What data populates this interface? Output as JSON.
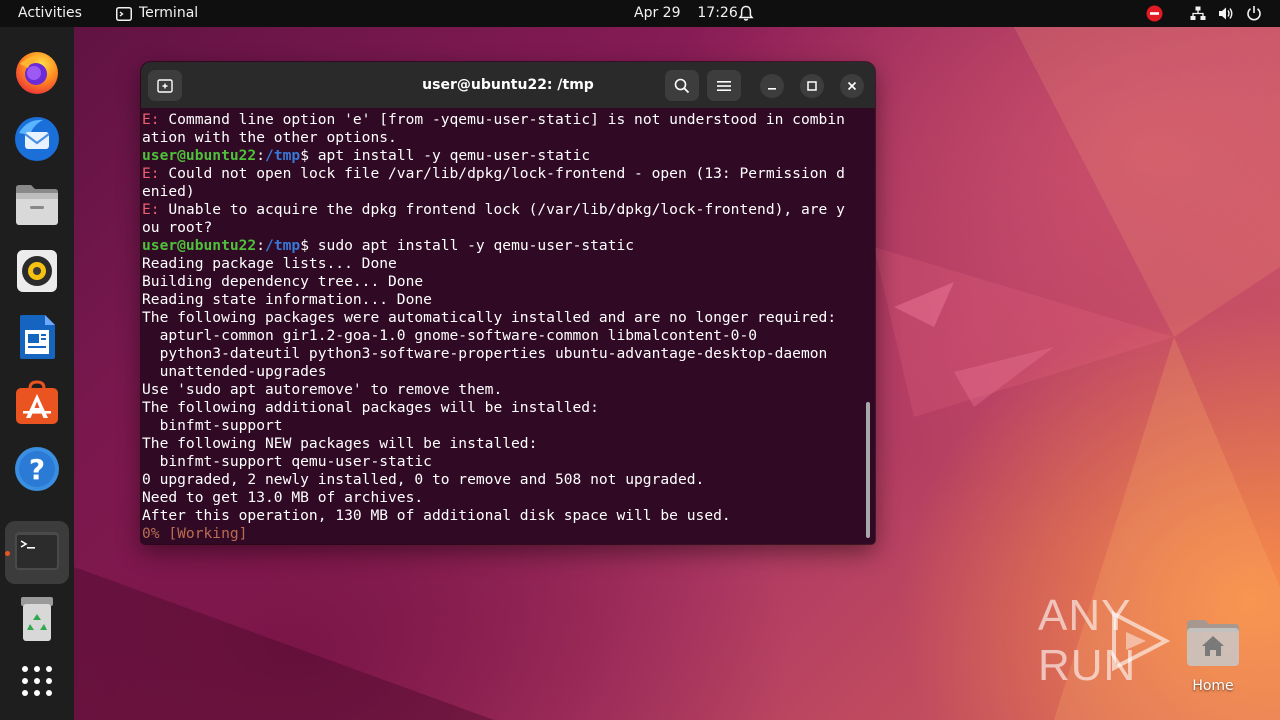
{
  "topbar": {
    "activities": "Activities",
    "app_name": "Terminal",
    "date": "Apr 29",
    "time": "17:26"
  },
  "dock": {
    "apps": [
      {
        "name": "Firefox",
        "icon": "firefox-icon"
      },
      {
        "name": "Thunderbird",
        "icon": "thunderbird-icon"
      },
      {
        "name": "Files",
        "icon": "files-icon"
      },
      {
        "name": "Rhythmbox",
        "icon": "rhythmbox-icon"
      },
      {
        "name": "LibreOffice Writer",
        "icon": "writer-icon"
      },
      {
        "name": "Ubuntu Software",
        "icon": "software-icon"
      },
      {
        "name": "Help",
        "icon": "help-icon"
      },
      {
        "name": "Terminal",
        "icon": "terminal-icon",
        "active": true
      },
      {
        "name": "Trash",
        "icon": "trash-icon"
      },
      {
        "name": "Show Applications",
        "icon": "app-grid-icon"
      }
    ]
  },
  "terminal": {
    "title": "user@ubuntu22: /tmp",
    "prompt_user": "user@ubuntu22",
    "prompt_sep": ":",
    "prompt_path": "/tmp",
    "prompt_dollar": "$",
    "error_prefix": "E:",
    "lines": {
      "l01_rest": " Command line option 'e' [from -yqemu-user-static] is not understood in combin",
      "l02": "ation with the other options.",
      "l03_cmd": " apt install -y qemu-user-static",
      "l04_rest": " Could not open lock file /var/lib/dpkg/lock-frontend - open (13: Permission d",
      "l05": "enied)",
      "l06_rest": " Unable to acquire the dpkg frontend lock (/var/lib/dpkg/lock-frontend), are y",
      "l07": "ou root?",
      "l08_cmd": " sudo apt install -y qemu-user-static",
      "l09": "Reading package lists... Done",
      "l10": "Building dependency tree... Done",
      "l11": "Reading state information... Done",
      "l12": "The following packages were automatically installed and are no longer required:",
      "l13": "  apturl-common gir1.2-goa-1.0 gnome-software-common libmalcontent-0-0",
      "l14": "  python3-dateutil python3-software-properties ubuntu-advantage-desktop-daemon",
      "l15": "  unattended-upgrades",
      "l16": "Use 'sudo apt autoremove' to remove them.",
      "l17": "The following additional packages will be installed:",
      "l18": "  binfmt-support",
      "l19": "The following NEW packages will be installed:",
      "l20": "  binfmt-support qemu-user-static",
      "l21": "0 upgraded, 2 newly installed, 0 to remove and 508 not upgraded.",
      "l22": "Need to get 13.0 MB of archives.",
      "l23": "After this operation, 130 MB of additional disk space will be used.",
      "l24": "0% [Working]"
    }
  },
  "desktop": {
    "home_label": "Home",
    "watermark": "ANY RUN"
  },
  "colors": {
    "terminal_bg": "#300a24",
    "prompt_user": "#4ec13b",
    "prompt_path": "#3877d6",
    "error": "#f15d70",
    "ubuntu_orange": "#e95420"
  }
}
